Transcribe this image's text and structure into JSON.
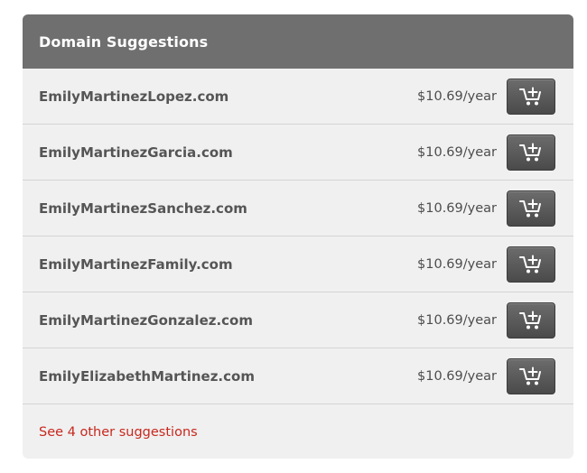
{
  "panel": {
    "title": "Domain Suggestions"
  },
  "suggestions": [
    {
      "domain": "EmilyMartinezLopez.com",
      "price": "$10.69/year",
      "icon": "add-to-cart-icon"
    },
    {
      "domain": "EmilyMartinezGarcia.com",
      "price": "$10.69/year",
      "icon": "add-to-cart-icon"
    },
    {
      "domain": "EmilyMartinezSanchez.com",
      "price": "$10.69/year",
      "icon": "add-to-cart-icon"
    },
    {
      "domain": "EmilyMartinezFamily.com",
      "price": "$10.69/year",
      "icon": "add-to-cart-icon"
    },
    {
      "domain": "EmilyMartinezGonzalez.com",
      "price": "$10.69/year",
      "icon": "add-to-cart-icon"
    },
    {
      "domain": "EmilyElizabethMartinez.com",
      "price": "$10.69/year",
      "icon": "add-to-cart-icon"
    }
  ],
  "footer": {
    "more_link": "See 4 other suggestions"
  },
  "colors": {
    "header_bg": "#6f6f6f",
    "panel_bg": "#f0f0f0",
    "link": "#c8281e",
    "button": "#555555"
  }
}
